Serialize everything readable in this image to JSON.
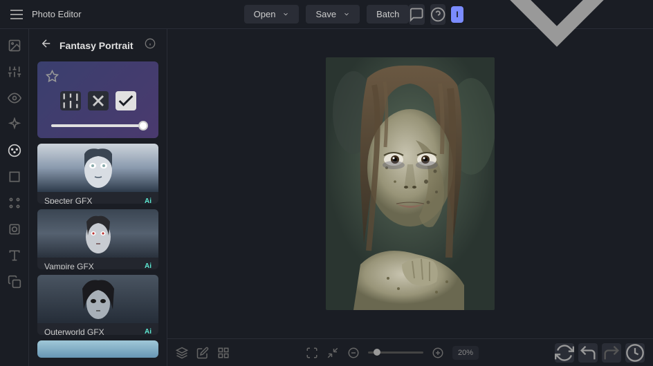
{
  "app": {
    "title": "Photo Editor"
  },
  "header": {
    "open": "Open",
    "save": "Save",
    "batch": "Batch",
    "avatar_initial": "I"
  },
  "sidebar": {
    "title": "Fantasy Portrait",
    "effects": [
      {
        "label": "Specter GFX",
        "ai": "Ai"
      },
      {
        "label": "Vampire GFX",
        "ai": "Ai"
      },
      {
        "label": "Outerworld GFX",
        "ai": "Ai"
      }
    ]
  },
  "footer": {
    "zoom": "20%"
  },
  "colors": {
    "accent": "#7b8cff",
    "ai": "#5eead4"
  }
}
